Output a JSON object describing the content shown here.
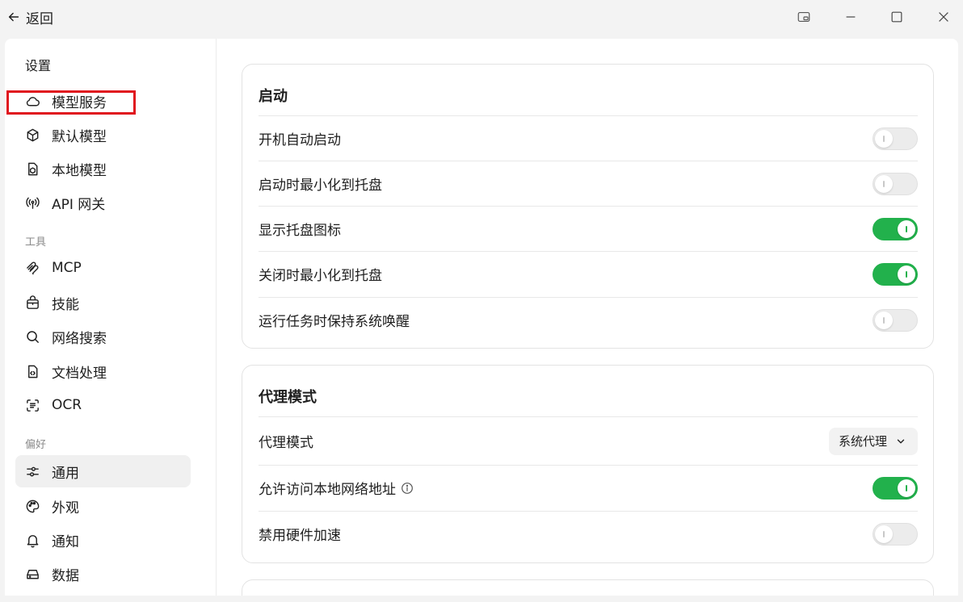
{
  "titlebar": {
    "back_label": "返回"
  },
  "sidebar": {
    "title": "设置",
    "items_model": [
      {
        "label": "模型服务",
        "icon": "cloud-icon"
      },
      {
        "label": "默认模型",
        "icon": "cube-icon"
      },
      {
        "label": "本地模型",
        "icon": "local-model-icon"
      },
      {
        "label": "API 网关",
        "icon": "antenna-icon"
      }
    ],
    "section_tools": "工具",
    "items_tools": [
      {
        "label": "MCP",
        "icon": "mcp-icon"
      },
      {
        "label": "技能",
        "icon": "skills-icon"
      },
      {
        "label": "网络搜索",
        "icon": "search-icon"
      },
      {
        "label": "文档处理",
        "icon": "document-icon"
      },
      {
        "label": "OCR",
        "icon": "scan-text-icon"
      }
    ],
    "section_prefs": "偏好",
    "items_prefs": [
      {
        "label": "通用",
        "icon": "sliders-icon",
        "active": true
      },
      {
        "label": "外观",
        "icon": "palette-icon"
      },
      {
        "label": "通知",
        "icon": "bell-icon"
      },
      {
        "label": "数据",
        "icon": "drive-icon"
      }
    ]
  },
  "startup": {
    "title": "启动",
    "rows": [
      {
        "label": "开机自动启动",
        "on": false
      },
      {
        "label": "启动时最小化到托盘",
        "on": false
      },
      {
        "label": "显示托盘图标",
        "on": true
      },
      {
        "label": "关闭时最小化到托盘",
        "on": true
      },
      {
        "label": "运行任务时保持系统唤醒",
        "on": false
      }
    ]
  },
  "proxy": {
    "title": "代理模式",
    "mode_label": "代理模式",
    "mode_value": "系统代理",
    "local_network_label": "允许访问本地网络地址",
    "local_network_on": true,
    "hw_accel_label": "禁用硬件加速",
    "hw_accel_on": false
  },
  "colors": {
    "accent_green": "#22b14c",
    "highlight_red": "#e0141e"
  }
}
